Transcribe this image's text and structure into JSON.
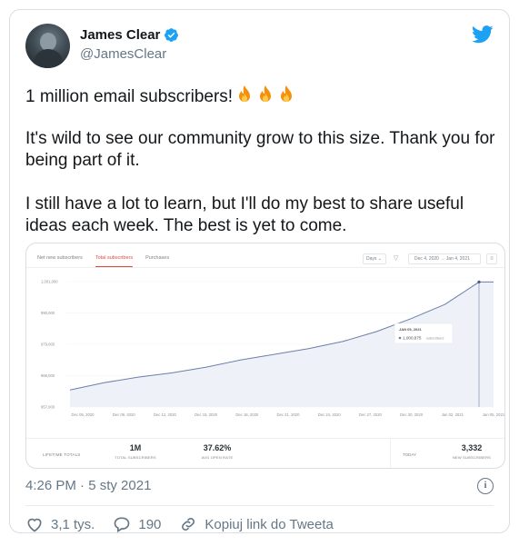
{
  "tweet": {
    "author_name": "James Clear",
    "handle": "@JamesClear",
    "line1": "1 million email subscribers!",
    "line2": "It's wild to see our community grow to this size. Thank you for being part of it.",
    "line3": "I still have a lot to learn, but I'll do my best to share useful ideas each week. The best is yet to come.",
    "timestamp": "4:26 PM · 5 sty 2021",
    "likes": "3,1 tys.",
    "replies": "190",
    "copy_link": "Kopiuj link do Tweeta",
    "brand_color": "#1da1f2",
    "icons": [
      "verified-badge-icon",
      "twitter-bird-icon",
      "fire-emoji",
      "info-icon",
      "heart-icon",
      "reply-bubble-icon",
      "link-icon"
    ]
  },
  "dashboard": {
    "tabs": [
      "Net new subscribers",
      "Total subscribers",
      "Purchases"
    ],
    "active_tab": "Total subscribers",
    "range_select": "Days",
    "date_range": "Dec 4, 2020 → Jan 4, 2021",
    "accent_color": "#e0493a",
    "lifetime_label": "LIFETIME TOTALS",
    "stats": [
      {
        "value": "1M",
        "label": "TOTAL SUBSCRIBERS"
      },
      {
        "value": "37.62%",
        "label": "AVG OPEN RATE"
      }
    ],
    "today_label": "TODAY",
    "today_stat": {
      "value": "3,332",
      "label": "NEW SUBSCRIBERS"
    }
  },
  "chart_data": {
    "type": "area",
    "x": [
      "Dec 06, 2020",
      "Dec 09, 2020",
      "Dec 12, 2020",
      "Dec 15, 2020",
      "Dec 18, 2020",
      "Dec 21, 2020",
      "Dec 24, 2020",
      "Dec 27, 2020",
      "Dec 30, 2020",
      "Jan 02, 2021",
      "Jan 05, 2021"
    ],
    "y_ticks": [
      "957,000",
      "968,000",
      "979,000",
      "990,000",
      "1,001,000"
    ],
    "series": [
      {
        "values": [
          963000,
          965500,
          967500,
          969000,
          971000,
          973500,
          975500,
          977500,
          980000,
          983500,
          988000,
          993000,
          1000875,
          1000875
        ]
      }
    ],
    "x_values": [
      "Dec 04",
      "Dec 06",
      "Dec 09",
      "Dec 12",
      "Dec 15",
      "Dec 18",
      "Dec 21",
      "Dec 24",
      "Dec 27",
      "Dec 30",
      "Jan 02",
      "Jan 04",
      "Jan 05",
      "Jan 05"
    ],
    "ylim": [
      957000,
      1001000
    ],
    "tooltip": {
      "date": "JAN 05, 2021",
      "value": "1,000,875",
      "unit": "subscribers"
    },
    "line_color": "#6b7fa8",
    "fill_color": "#eef1f7"
  }
}
